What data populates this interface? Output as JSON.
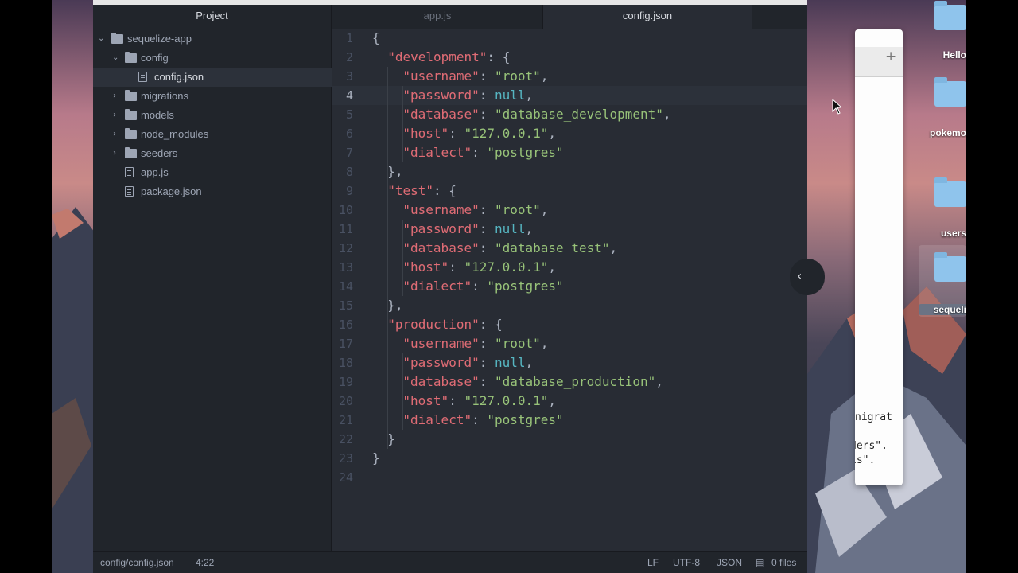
{
  "desktop": {
    "icons": [
      {
        "label": "Hello"
      },
      {
        "label": "pokemo"
      },
      {
        "label": "users"
      },
      {
        "label": "sequeli"
      }
    ],
    "background_window": {
      "lines": [
        "nigrat",
        "ders\".",
        "is\"."
      ]
    }
  },
  "tree": {
    "header": "Project",
    "items": [
      {
        "label": "sequelize-app"
      },
      {
        "label": "config"
      },
      {
        "label": "config.json"
      },
      {
        "label": "migrations"
      },
      {
        "label": "models"
      },
      {
        "label": "node_modules"
      },
      {
        "label": "seeders"
      },
      {
        "label": "app.js"
      },
      {
        "label": "package.json"
      }
    ]
  },
  "tabs": [
    {
      "label": "app.js",
      "active": false
    },
    {
      "label": "config.json",
      "active": true
    }
  ],
  "code": {
    "current_line": 4,
    "line_numbers": [
      "1",
      "2",
      "3",
      "4",
      "5",
      "6",
      "7",
      "8",
      "9",
      "10",
      "11",
      "12",
      "13",
      "14",
      "15",
      "16",
      "17",
      "18",
      "19",
      "20",
      "21",
      "22",
      "23",
      "24"
    ],
    "tokens": {
      "l1": [
        "{"
      ],
      "l2": [
        "\"development\"",
        ": {"
      ],
      "l3": [
        "\"username\"",
        ": ",
        "\"root\"",
        ","
      ],
      "l4": [
        "\"password\"",
        ": ",
        "null",
        ","
      ],
      "l5": [
        "\"database\"",
        ": ",
        "\"database_development\"",
        ","
      ],
      "l6": [
        "\"host\"",
        ": ",
        "\"127.0.0.1\"",
        ","
      ],
      "l7": [
        "\"dialect\"",
        ": ",
        "\"postgres\""
      ],
      "l8": [
        "},"
      ],
      "l9": [
        "\"test\"",
        ": {"
      ],
      "l10": [
        "\"username\"",
        ": ",
        "\"root\"",
        ","
      ],
      "l11": [
        "\"password\"",
        ": ",
        "null",
        ","
      ],
      "l12": [
        "\"database\"",
        ": ",
        "\"database_test\"",
        ","
      ],
      "l13": [
        "\"host\"",
        ": ",
        "\"127.0.0.1\"",
        ","
      ],
      "l14": [
        "\"dialect\"",
        ": ",
        "\"postgres\""
      ],
      "l15": [
        "},"
      ],
      "l16": [
        "\"production\"",
        ": {"
      ],
      "l17": [
        "\"username\"",
        ": ",
        "\"root\"",
        ","
      ],
      "l18": [
        "\"password\"",
        ": ",
        "null",
        ","
      ],
      "l19": [
        "\"database\"",
        ": ",
        "\"database_production\"",
        ","
      ],
      "l20": [
        "\"host\"",
        ": ",
        "\"127.0.0.1\"",
        ","
      ],
      "l21": [
        "\"dialect\"",
        ": ",
        "\"postgres\""
      ],
      "l22": [
        "}"
      ],
      "l23": [
        "}"
      ],
      "l24": [
        ""
      ]
    }
  },
  "statusbar": {
    "file_path": "config/config.json",
    "cursor_pos": "4:22",
    "line_ending": "LF",
    "encoding": "UTF-8",
    "grammar": "JSON",
    "git_files": "0 files"
  },
  "icons": {
    "expand": "chevron-down-icon",
    "collapse": "chevron-right-icon",
    "folder": "folder-icon",
    "file": "file-icon",
    "pane_toggle": "chevron-left-icon"
  },
  "colors": {
    "editor_bg": "#282c34",
    "tree_bg": "#21252b",
    "key": "#e06c75",
    "string": "#98c379",
    "null": "#56b6c2"
  }
}
